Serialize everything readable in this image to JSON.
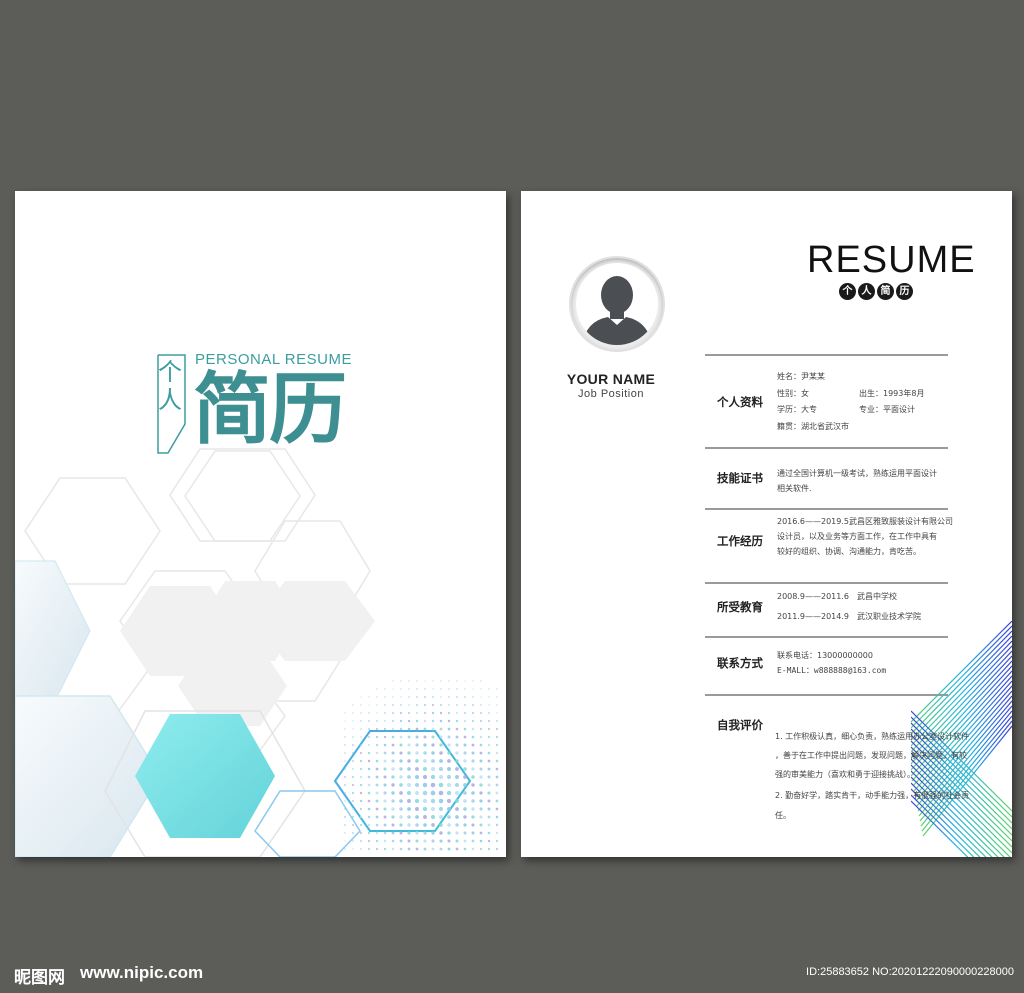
{
  "cover": {
    "title_en": "PERSONAL RESUME",
    "title_small": "个人",
    "title_big": "简历"
  },
  "resume": {
    "heading": "RESUME",
    "badges": [
      "个",
      "人",
      "简",
      "历"
    ],
    "avatar_icon": "person-silhouette-icon",
    "name": "YOUR NAME",
    "position": "Job Position",
    "sections": {
      "profile": {
        "label": "个人资料",
        "name_line": "姓名：尹某某",
        "gender_line": "性别：女",
        "birth_line": "出生：1993年8月",
        "education_line": "学历：大专",
        "major_line": "专业：平面设计",
        "hometown_line": "籍贯：湖北省武汉市"
      },
      "skills": {
        "label": "技能证书",
        "line1": "通过全国计算机一级考试，熟练运用平面设计",
        "line2": "相关软件."
      },
      "work": {
        "label": "工作经历",
        "line1": "2016.6——2019.5武昌区雅致服装设计有限公司",
        "line2": "设计员，以及业务等方面工作，在工作中具有",
        "line3": "较好的组织、协调、沟通能力，肯吃苦。"
      },
      "education": {
        "label": "所受教育",
        "row1_date": "2008.9——2011.6",
        "row1_school": "武昌中学校",
        "row2_date": "2011.9——2014.9",
        "row2_school": "武汉职业技术学院"
      },
      "contact": {
        "label": "联系方式",
        "phone": "联系电话：13000000000",
        "email": "E-MALL：w888888@163.com"
      },
      "self": {
        "label": "自我评价",
        "line1": "1. 工作积极认真，细心负责，熟练运用办公室设计软件",
        "line2": "，善于在工作中提出问题，发现问题，解决问题，有较",
        "line3": "强的审美能力（喜欢和勇于迎接挑战）。",
        "line4": "2. 勤奋好学，踏实肯干，动手能力强，有很强的社会责",
        "line5": "任。"
      }
    }
  },
  "watermark": {
    "logo_text": "昵图网",
    "site": "www.nipic.com",
    "id_text": "ID:25883652 NO:20201222090000228000"
  },
  "colors": {
    "background": "#5c5d59",
    "teal": "#3c9d9f",
    "cyan_hex": "#7fe3e6"
  }
}
